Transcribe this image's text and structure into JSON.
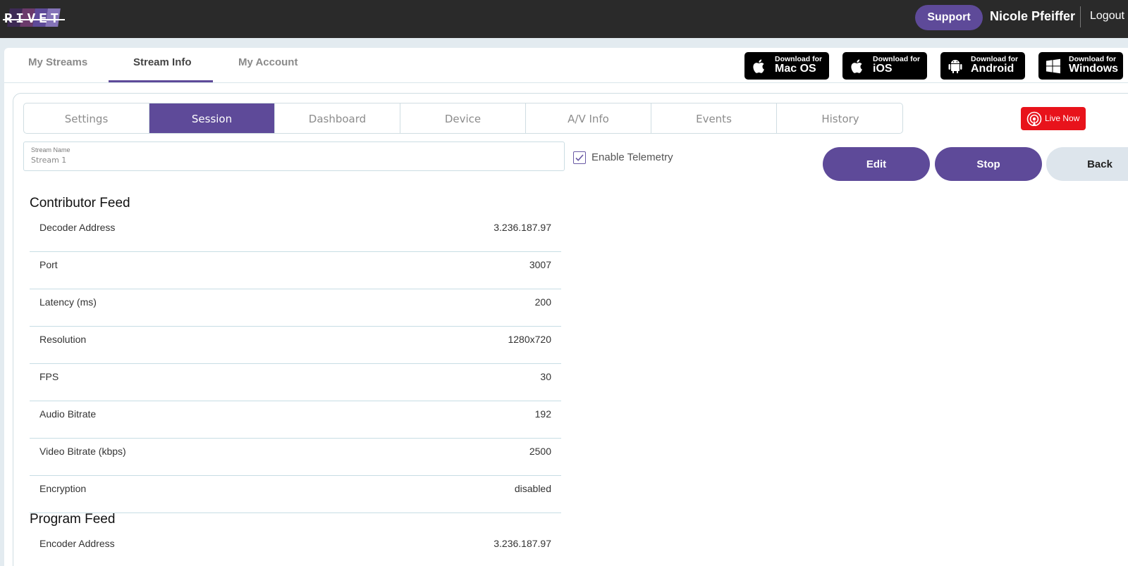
{
  "header": {
    "logo_text": "RIVET",
    "support_label": "Support",
    "user_name": "Nicole Pfeiffer",
    "logout_label": "Logout",
    "logo_colors": [
      "#3d2a55",
      "#6b3a6b",
      "#5e4a99",
      "#8574b8"
    ]
  },
  "main_tabs": [
    {
      "label": "My Streams",
      "active": false
    },
    {
      "label": "Stream Info",
      "active": true
    },
    {
      "label": "My Account",
      "active": false
    }
  ],
  "downloads": [
    {
      "small": "Download for",
      "big": "Mac OS",
      "icon": "apple-icon"
    },
    {
      "small": "Download for",
      "big": "iOS",
      "icon": "apple-icon"
    },
    {
      "small": "Download for",
      "big": "Android",
      "icon": "android-icon"
    },
    {
      "small": "Download for",
      "big": "Windows",
      "icon": "windows-icon"
    }
  ],
  "sub_tabs": [
    {
      "label": "Settings",
      "active": false
    },
    {
      "label": "Session",
      "active": true
    },
    {
      "label": "Dashboard",
      "active": false
    },
    {
      "label": "Device",
      "active": false
    },
    {
      "label": "A/V Info",
      "active": false
    },
    {
      "label": "Events",
      "active": false
    },
    {
      "label": "History",
      "active": false
    }
  ],
  "live_badge": {
    "label": "Live Now",
    "icon": "broadcast-icon"
  },
  "stream_name": {
    "label": "Stream Name",
    "value": "Stream 1"
  },
  "telemetry": {
    "label": "Enable Telemetry",
    "checked": true
  },
  "actions": {
    "edit": "Edit",
    "stop": "Stop",
    "back": "Back"
  },
  "contributor_feed": {
    "title": "Contributor Feed",
    "rows": [
      {
        "label": "Decoder Address",
        "value": "3.236.187.97"
      },
      {
        "label": "Port",
        "value": "3007"
      },
      {
        "label": "Latency (ms)",
        "value": "200"
      },
      {
        "label": "Resolution",
        "value": "1280x720"
      },
      {
        "label": "FPS",
        "value": "30"
      },
      {
        "label": "Audio Bitrate",
        "value": "192"
      },
      {
        "label": "Video Bitrate (kbps)",
        "value": "2500"
      },
      {
        "label": "Encryption",
        "value": "disabled"
      }
    ]
  },
  "program_feed": {
    "title": "Program Feed",
    "rows": [
      {
        "label": "Encoder Address",
        "value": "3.236.187.97"
      }
    ]
  },
  "colors": {
    "accent": "#5e4a99",
    "live_red": "#e8131b",
    "topbar": "#2a2a2a"
  }
}
